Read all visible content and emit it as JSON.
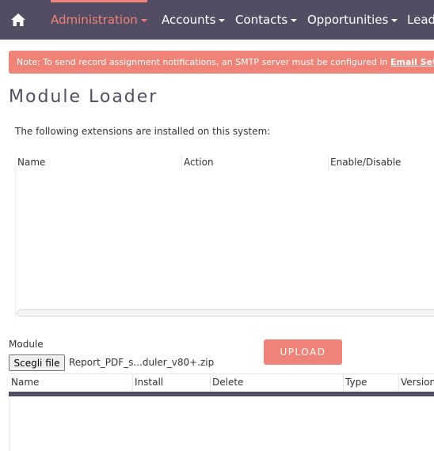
{
  "nav": {
    "items": [
      {
        "label": "Administration",
        "active": true
      },
      {
        "label": "Accounts",
        "active": false
      },
      {
        "label": "Contacts",
        "active": false
      },
      {
        "label": "Opportunities",
        "active": false
      },
      {
        "label": "Leads",
        "active": false
      }
    ],
    "home_icon": "home-icon"
  },
  "notice": {
    "text": "Note: To send record assignment notifications, an SMTP server must be configured in ",
    "link": "Email Settings",
    "suffix": "."
  },
  "page": {
    "title": "Module Loader",
    "intro": "The following extensions are installed on this system:"
  },
  "extensions_table": {
    "columns": [
      "Name",
      "Action",
      "Enable/Disable"
    ],
    "rows": []
  },
  "upload": {
    "module_label": "Module",
    "file_button": "Scegli file",
    "file_name": "Report_PDF_s...duler_v80+.zip",
    "upload_button": "UPLOAD"
  },
  "upload_table": {
    "columns": [
      "Name",
      "Install",
      "Delete",
      "Type",
      "Version"
    ]
  },
  "colors": {
    "nav_bg": "#534d64",
    "accent": "#f08377",
    "text": "#534d64"
  }
}
